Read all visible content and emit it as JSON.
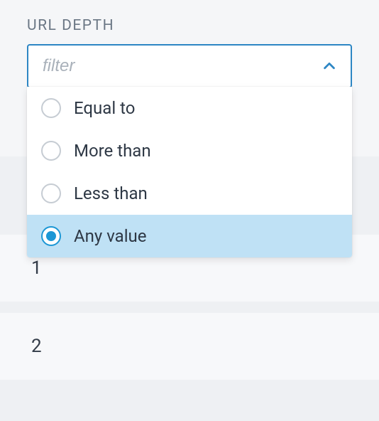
{
  "filter": {
    "label": "URL DEPTH",
    "placeholder": "filter",
    "options": [
      {
        "label": "Equal to",
        "selected": false
      },
      {
        "label": "More than",
        "selected": false
      },
      {
        "label": "Less than",
        "selected": false
      },
      {
        "label": "Any value",
        "selected": true
      }
    ]
  },
  "rows": {
    "values": [
      "1",
      "2"
    ]
  }
}
